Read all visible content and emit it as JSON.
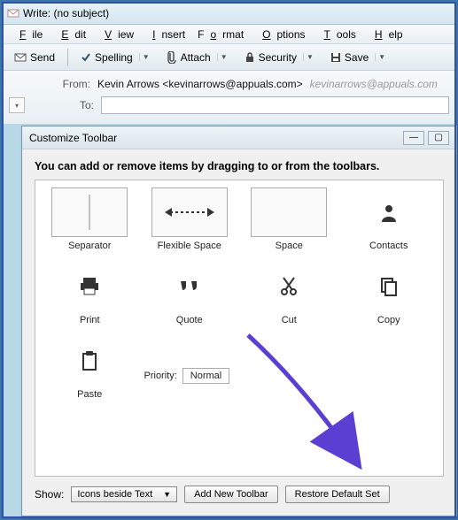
{
  "window": {
    "title": "Write: (no subject)"
  },
  "menu": {
    "items": [
      "File",
      "Edit",
      "View",
      "Insert",
      "Format",
      "Options",
      "Tools",
      "Help"
    ]
  },
  "toolbar": {
    "send": "Send",
    "spelling": "Spelling",
    "attach": "Attach",
    "security": "Security",
    "save": "Save"
  },
  "headers": {
    "from_label": "From:",
    "from_value": "Kevin Arrows <kevinarrows@appuals.com>",
    "from_grey": "kevinarrows@appuals.com",
    "to_label": "To:",
    "to_value": ""
  },
  "dialog": {
    "title": "Customize Toolbar",
    "instruction": "You can add or remove items by dragging to or from the toolbars.",
    "items": {
      "separator": "Separator",
      "flexible_space": "Flexible Space",
      "space": "Space",
      "contacts": "Contacts",
      "print": "Print",
      "quote": "Quote",
      "cut": "Cut",
      "copy": "Copy",
      "paste": "Paste"
    },
    "priority": {
      "label": "Priority:",
      "value": "Normal"
    },
    "bottom": {
      "show_label": "Show:",
      "show_value": "Icons beside Text",
      "add_btn": "Add New Toolbar",
      "restore_btn": "Restore Default Set"
    }
  }
}
